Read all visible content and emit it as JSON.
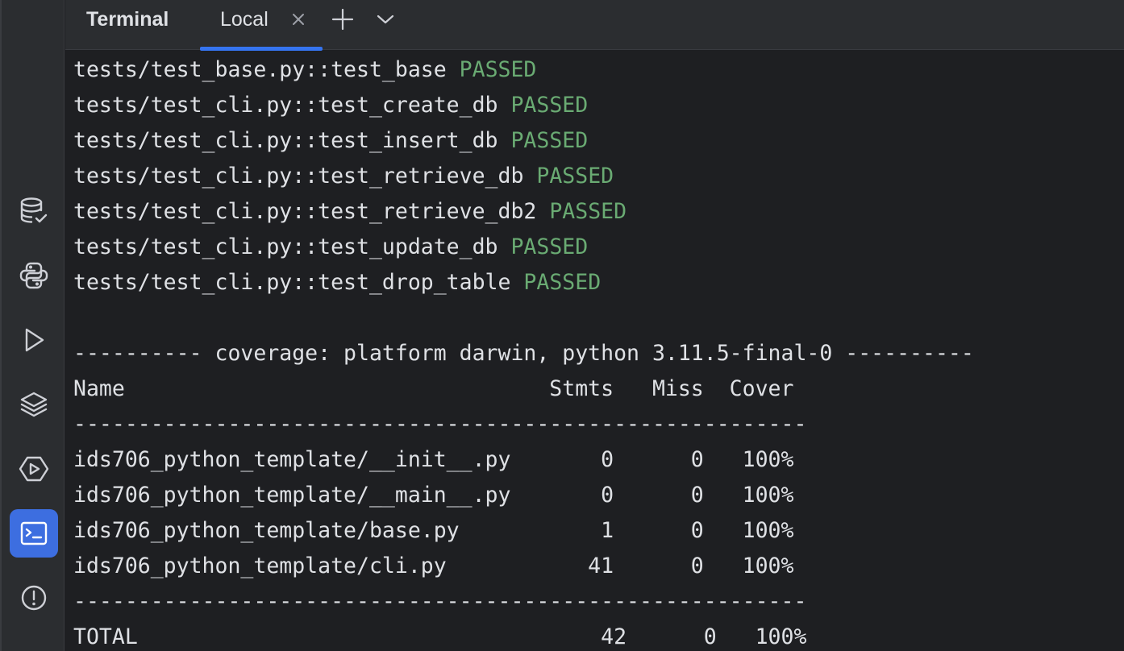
{
  "header": {
    "title": "Terminal",
    "tabs": [
      {
        "label": "Local"
      }
    ]
  },
  "sidebar": {
    "items": [
      {
        "icon": "database-check-icon"
      },
      {
        "icon": "python-icon"
      },
      {
        "icon": "run-icon"
      },
      {
        "icon": "layers-icon"
      },
      {
        "icon": "services-icon"
      },
      {
        "icon": "terminal-icon",
        "active": true
      },
      {
        "icon": "problems-icon"
      }
    ]
  },
  "terminal": {
    "tests": [
      {
        "path": "tests/test_base.py::test_base",
        "status": "PASSED"
      },
      {
        "path": "tests/test_cli.py::test_create_db",
        "status": "PASSED"
      },
      {
        "path": "tests/test_cli.py::test_insert_db",
        "status": "PASSED"
      },
      {
        "path": "tests/test_cli.py::test_retrieve_db",
        "status": "PASSED"
      },
      {
        "path": "tests/test_cli.py::test_retrieve_db2",
        "status": "PASSED"
      },
      {
        "path": "tests/test_cli.py::test_update_db",
        "status": "PASSED"
      },
      {
        "path": "tests/test_cli.py::test_drop_table",
        "status": "PASSED"
      }
    ],
    "coverage_header": "---------- coverage: platform darwin, python 3.11.5-final-0 ----------",
    "table_header": "Name                                 Stmts   Miss  Cover",
    "separator": "---------------------------------------------------------",
    "rows": [
      "ids706_python_template/__init__.py       0      0   100%",
      "ids706_python_template/__main__.py       0      0   100%",
      "ids706_python_template/base.py           1      0   100%",
      "ids706_python_template/cli.py           41      0   100%"
    ],
    "separator2": "---------------------------------------------------------",
    "total": "TOTAL                                    42      0   100%"
  },
  "colors": {
    "passed": "#6aab73",
    "accent": "#3574f0",
    "active_tool": "#3d6ee0",
    "text": "#dfe1e5",
    "background": "#1e1f22",
    "chrome": "#2b2d30"
  }
}
